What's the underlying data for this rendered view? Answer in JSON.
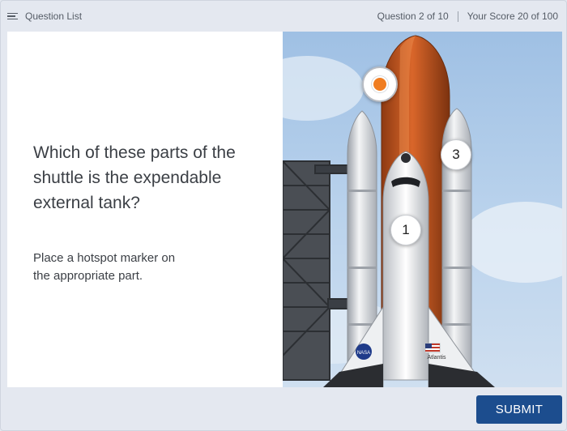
{
  "topbar": {
    "question_list_label": "Question List",
    "question_counter": "Question 2 of 10",
    "score": "Your Score 20 of 100"
  },
  "question": {
    "prompt": "Which of these parts of the shuttle is the expendable external tank?",
    "instruction": "Place a hotspot marker on the appropriate part."
  },
  "image": {
    "orbiter_logo_text": "NASA",
    "orbiter_name_text": "Atlantis"
  },
  "hotspots": [
    {
      "label": "1"
    },
    {
      "label": "3"
    }
  ],
  "footer": {
    "submit_label": "SUBMIT"
  },
  "colors": {
    "accent": "#1c4d8e",
    "marker_active": "#f07d21",
    "external_tank": "#c8561e"
  }
}
